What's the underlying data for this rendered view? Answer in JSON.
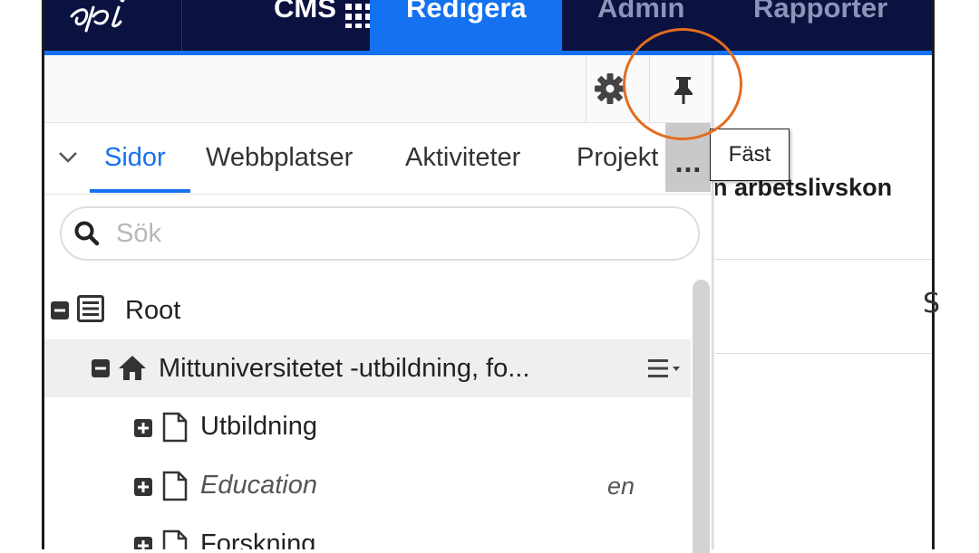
{
  "topnav": {
    "logo": "epi",
    "cms_label": "CMS",
    "items": [
      {
        "label": "Redigera",
        "active": true
      },
      {
        "label": "Admin"
      },
      {
        "label": "Rapporter"
      }
    ]
  },
  "toolbar": {
    "settings_icon": "gear-icon",
    "pin_icon": "pin-icon",
    "pin_tooltip": "Fäst"
  },
  "tabs": {
    "items": [
      {
        "label": "Sidor",
        "active": true
      },
      {
        "label": "Webbplatser"
      },
      {
        "label": "Aktiviteter"
      },
      {
        "label": "Projekt"
      }
    ],
    "more_label": "..."
  },
  "search": {
    "placeholder": "Sök",
    "value": ""
  },
  "tree": {
    "root": {
      "label": "Root"
    },
    "site": {
      "label": "Mittuniversitetet -utbildning, fo..."
    },
    "children": [
      {
        "label": "Utbildning",
        "lang": ""
      },
      {
        "label": "Education",
        "lang": "en"
      },
      {
        "label": "Forskning",
        "lang": ""
      }
    ]
  },
  "main": {
    "title_fragment": "n arbetslivskon",
    "column_fragment": "S"
  },
  "colors": {
    "nav_bg": "#0b1240",
    "accent": "#1471f0",
    "highlight": "#e36d21"
  }
}
